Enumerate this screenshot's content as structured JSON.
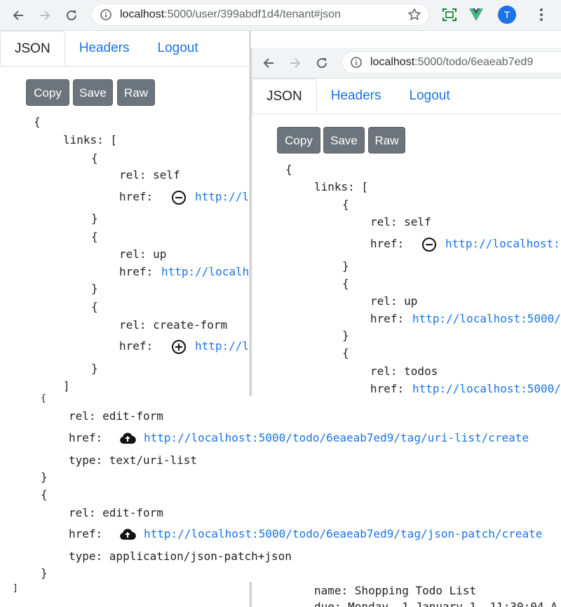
{
  "browser_left": {
    "url_host": "localhost",
    "url_path": ":5000/user/399abdf1d4/tenant#json",
    "avatar_letter": "T"
  },
  "browser_right": {
    "url_host": "localhost",
    "url_path": ":5000/todo/6eaeab7ed9"
  },
  "tabs": {
    "json": "JSON",
    "headers": "Headers",
    "logout": "Logout"
  },
  "buttons": {
    "copy": "Copy",
    "save": "Save",
    "raw": "Raw"
  },
  "left_json": {
    "open_brace": "{",
    "links_key": "links: [",
    "l1_open": "{",
    "l1_rel": "rel: self",
    "l1_href_key": "href:",
    "l1_href": "http://l",
    "l1_close": "}",
    "l2_open": "{",
    "l2_rel": "rel: up",
    "l2_href_key": "href:",
    "l2_href": "http://localh",
    "l2_close": "}",
    "l3_open": "{",
    "l3_rel": "rel: create-form",
    "l3_href_key": "href:",
    "l3_href": "http://l",
    "l3_close": "}",
    "links_close": "]"
  },
  "right_json": {
    "open_brace": "{",
    "links_key": "links: [",
    "r1_open": "{",
    "r1_rel": "rel: self",
    "r1_href_key": "href:",
    "r1_href": "http://localhost:",
    "r1_close": "}",
    "r2_open": "{",
    "r2_rel": "rel: up",
    "r2_href_key": "href:",
    "r2_href": "http://localhost:5000/",
    "r2_close": "}",
    "r3_open": "{",
    "r3_rel": "rel: todos",
    "r3_href_key": "href:",
    "r3_href": "http://localhost:5000/",
    "bottom1": "name: Shopping Todo List",
    "bottom2": "due: Monday, 1 January 1, 11:30:04 A"
  },
  "overlay": {
    "partial_open": "{",
    "o1_rel": "rel: edit-form",
    "o1_href_key": "href:",
    "o1_href": "http://localhost:5000/todo/6eaeab7ed9/tag/uri-list/create",
    "o1_type": "type: text/uri-list",
    "o1_close": "}",
    "o2_open": "{",
    "o2_rel": "rel: edit-form",
    "o2_href_key": "href:",
    "o2_href": "http://localhost:5000/todo/6eaeab7ed9/tag/json-patch/create",
    "o2_type": "type: application/json-patch+json",
    "o2_close": "}",
    "partial_close": "]"
  }
}
